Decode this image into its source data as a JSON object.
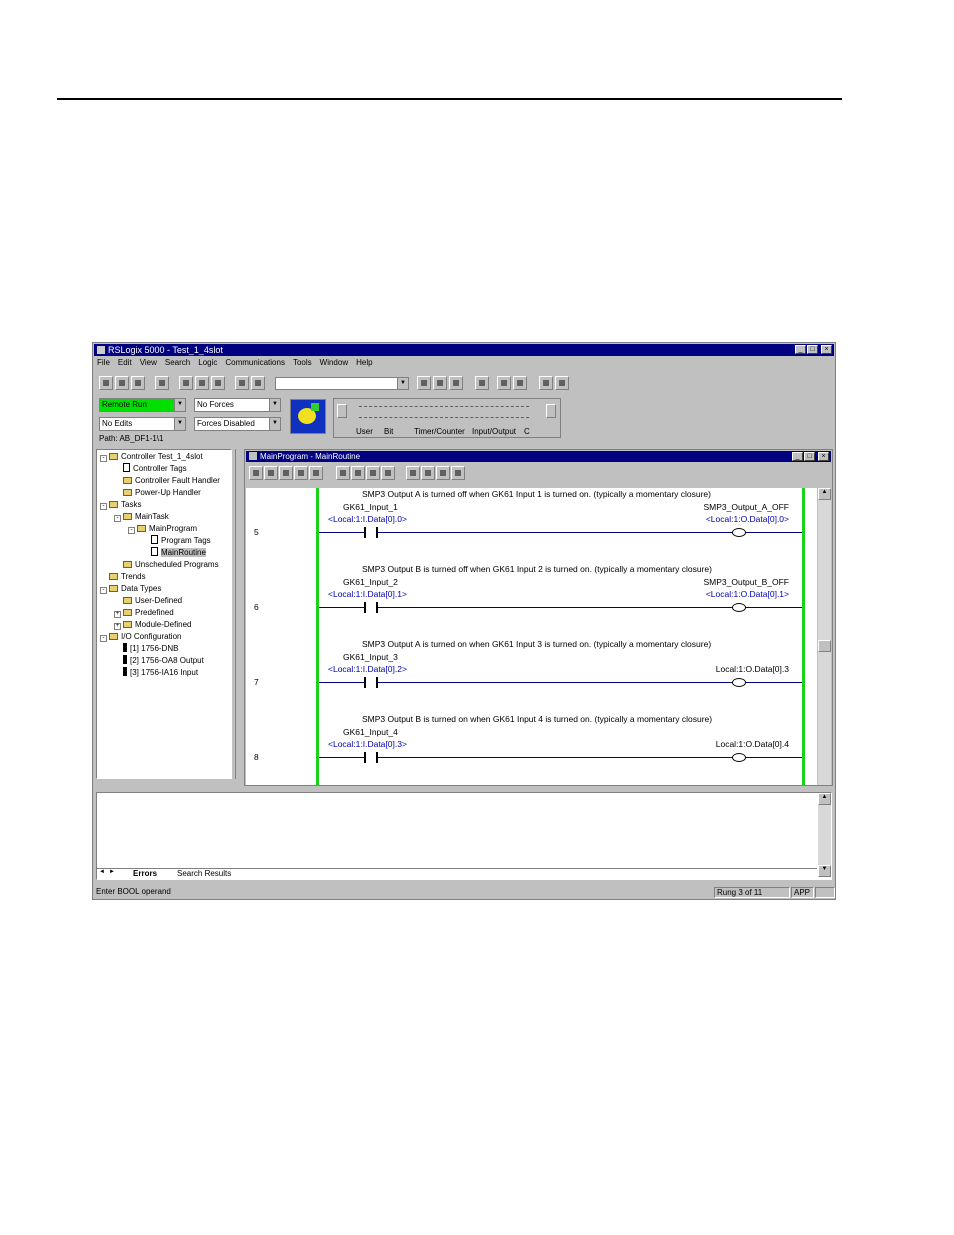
{
  "app": {
    "title": "RSLogix 5000 - Test_1_4slot"
  },
  "menu": [
    "File",
    "Edit",
    "View",
    "Search",
    "Logic",
    "Communications",
    "Tools",
    "Window",
    "Help"
  ],
  "controller_status": {
    "mode": "Remote Run",
    "forces": "No Forces",
    "edits": "No Edits",
    "forces_state": "Forces Disabled",
    "path": "Path: AB_DF1-1\\1"
  },
  "instruction_tabs": [
    "User",
    "Bit",
    "Timer/Counter",
    "Input/Output",
    "C"
  ],
  "tree": [
    {
      "label": "Controller Test_1_4slot",
      "indent": 0,
      "icon": "folder",
      "toggle": "-"
    },
    {
      "label": "Controller Tags",
      "indent": 1,
      "icon": "doc"
    },
    {
      "label": "Controller Fault Handler",
      "indent": 1,
      "icon": "folder"
    },
    {
      "label": "Power-Up Handler",
      "indent": 1,
      "icon": "folder"
    },
    {
      "label": "Tasks",
      "indent": 0,
      "icon": "folder",
      "toggle": "-"
    },
    {
      "label": "MainTask",
      "indent": 1,
      "icon": "folder",
      "toggle": "-"
    },
    {
      "label": "MainProgram",
      "indent": 2,
      "icon": "folder",
      "toggle": "-"
    },
    {
      "label": "Program Tags",
      "indent": 3,
      "icon": "doc"
    },
    {
      "label": "MainRoutine",
      "indent": 3,
      "icon": "doc",
      "selected": true
    },
    {
      "label": "Unscheduled Programs",
      "indent": 1,
      "icon": "folder"
    },
    {
      "label": "Trends",
      "indent": 0,
      "icon": "folder"
    },
    {
      "label": "Data Types",
      "indent": 0,
      "icon": "folder",
      "toggle": "-"
    },
    {
      "label": "User-Defined",
      "indent": 1,
      "icon": "folder"
    },
    {
      "label": "Predefined",
      "indent": 1,
      "icon": "folder",
      "toggle": "+"
    },
    {
      "label": "Module-Defined",
      "indent": 1,
      "icon": "folder",
      "toggle": "+"
    },
    {
      "label": "I/O Configuration",
      "indent": 0,
      "icon": "folder",
      "toggle": "-"
    },
    {
      "label": "[1] 1756-DNB",
      "indent": 1,
      "icon": "module"
    },
    {
      "label": "[2] 1756-OA8 Output",
      "indent": 1,
      "icon": "module"
    },
    {
      "label": "[3] 1756-IA16 Input",
      "indent": 1,
      "icon": "module"
    }
  ],
  "routine_window": {
    "title": "MainProgram - MainRoutine"
  },
  "rungs": [
    {
      "number": "5",
      "comment": "SMP3 Output A is turned off when GK61 Input 1 is turned on. (typically a momentary closure)",
      "input_tag": "GK61_Input_1",
      "input_addr": "<Local:1:I.Data[0].0>",
      "output_tag": "SMP3_Output_A_OFF",
      "output_addr": "<Local:1:O.Data[0].0>"
    },
    {
      "number": "6",
      "comment": "SMP3 Output B is turned off when GK61 Input 2 is turned on. (typically a momentary closure)",
      "input_tag": "GK61_Input_2",
      "input_addr": "<Local:1:I.Data[0].1>",
      "output_tag": "SMP3_Output_B_OFF",
      "output_addr": "<Local:1:O.Data[0].1>"
    },
    {
      "number": "7",
      "comment": "SMP3 Output A is turned on when GK61 Input 3 is turned on. (typically a momentary closure)",
      "input_tag": "GK61_Input_3",
      "input_addr": "<Local:1:I.Data[0].2>",
      "output_tag": "",
      "output_addr": "Local:1:O.Data[0].3"
    },
    {
      "number": "8",
      "comment": "SMP3 Output B is turned on when GK61 Input 4 is turned on. (typically a momentary closure)",
      "input_tag": "GK61_Input_4",
      "input_addr": "<Local:1:I.Data[0].3>",
      "output_tag": "",
      "output_addr": "Local:1:O.Data[0].4"
    }
  ],
  "results_tabs": [
    "Errors",
    "Search Results"
  ],
  "status_bar": {
    "message": "Enter BOOL operand",
    "rung_info": "Rung 3 of 11",
    "mode": "APP"
  },
  "colors": {
    "rail": "#19d219",
    "mode_indicator": "#00e000",
    "title_bar": "#000080"
  }
}
